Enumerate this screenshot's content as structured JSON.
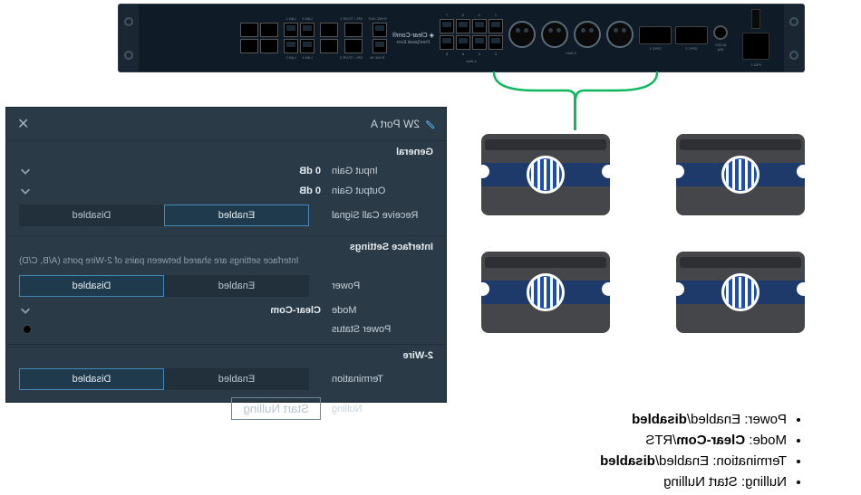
{
  "rack": {
    "brand": "Clear-Com",
    "model": "FreeSpeak Exxx",
    "labels": {
      "psu1": "PSU 1",
      "acdc": "AC/DC\n(IN)",
      "gpio2": "GPIO 2",
      "gpio1": "GPIO 1",
      "twowire": "2-Wire",
      "fourwire": "4-Wire",
      "lan3": "LAN 3",
      "lan1": "LAN 1",
      "lan2": "LAN 2",
      "lan4": "LAN 4",
      "sync_out": "SYNC OUT",
      "sync_in": "SYNC IN",
      "tcvr1": "SPL / TCVR 1",
      "tcvr2": "SPL / TCVR 2"
    }
  },
  "bullets": [
    {
      "k": "Power",
      "v": ": Enabled/",
      "b": "disabled"
    },
    {
      "k": "Mode",
      "v": ": ",
      "b": "Clear-Com",
      "tail": "/RTS"
    },
    {
      "k": "Termination",
      "v": ": Enabled/",
      "b": "disabled"
    },
    {
      "k": "Nulling",
      "v": ": Start Nulling"
    }
  ],
  "dlg": {
    "title": "2W Port A",
    "general": {
      "heading": "General",
      "input_gain_lbl": "Input Gain",
      "input_gain_val": "0 dB",
      "output_gain_lbl": "Output Gain",
      "output_gain_val": "0 dB",
      "recv_call_lbl": "Receive Call Signal",
      "enabled": "Enabled",
      "disabled": "Disabled"
    },
    "iface": {
      "heading": "Interface Settings",
      "hint": "Interface settings are shared between pairs of 2-Wire ports (A/B, C/D)",
      "power_lbl": "Power",
      "enabled": "Enabled",
      "disabled": "Disabled",
      "mode_lbl": "Mode",
      "mode_val": "Clear-Com",
      "pstatus_lbl": "Power Status"
    },
    "twowire": {
      "heading": "2-Wire",
      "term_lbl": "Termination",
      "enabled": "Enabled",
      "disabled": "Disabled",
      "nulling_lbl": "Nulling",
      "nulling_btn": "Start Nulling"
    }
  }
}
